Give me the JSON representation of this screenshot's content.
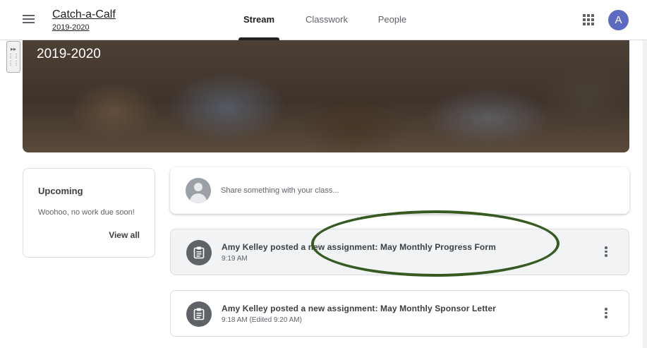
{
  "header": {
    "class_name": "Catch-a-Calf",
    "class_section": "2019-2020",
    "tabs": [
      {
        "label": "Stream"
      },
      {
        "label": "Classwork"
      },
      {
        "label": "People"
      }
    ],
    "avatar_letter": "A"
  },
  "banner": {
    "title": "2019-2020"
  },
  "upcoming": {
    "title": "Upcoming",
    "message": "Woohoo, no work due soon!",
    "view_all": "View all"
  },
  "share": {
    "placeholder": "Share something with your class..."
  },
  "posts": [
    {
      "title": "Amy Kelley posted a new assignment: May Monthly Progress Form",
      "time": "9:19 AM"
    },
    {
      "title": "Amy Kelley posted a new assignment: May Monthly Sponsor Letter",
      "time": "9:18 AM (Edited 9:20 AM)"
    }
  ],
  "colors": {
    "accent": "#202124",
    "avatar": "#5c6bc0",
    "annotation_ellipse": "#355a22"
  },
  "icons": [
    "menu-icon",
    "apps-grid-icon",
    "assignment-icon",
    "more-vert-icon",
    "user-placeholder-icon",
    "expand-icon"
  ]
}
